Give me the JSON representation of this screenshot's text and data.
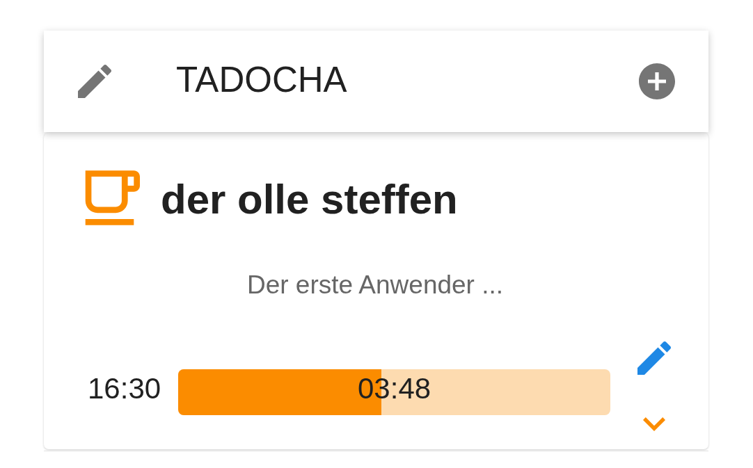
{
  "header": {
    "title": "TADOCHA"
  },
  "tasks": [
    {
      "title": "der olle steffen",
      "description": "Der erste Anwender ...",
      "start_time": "16:30",
      "elapsed": "03:48",
      "level": 0.47,
      "expanded": false
    }
  ]
}
